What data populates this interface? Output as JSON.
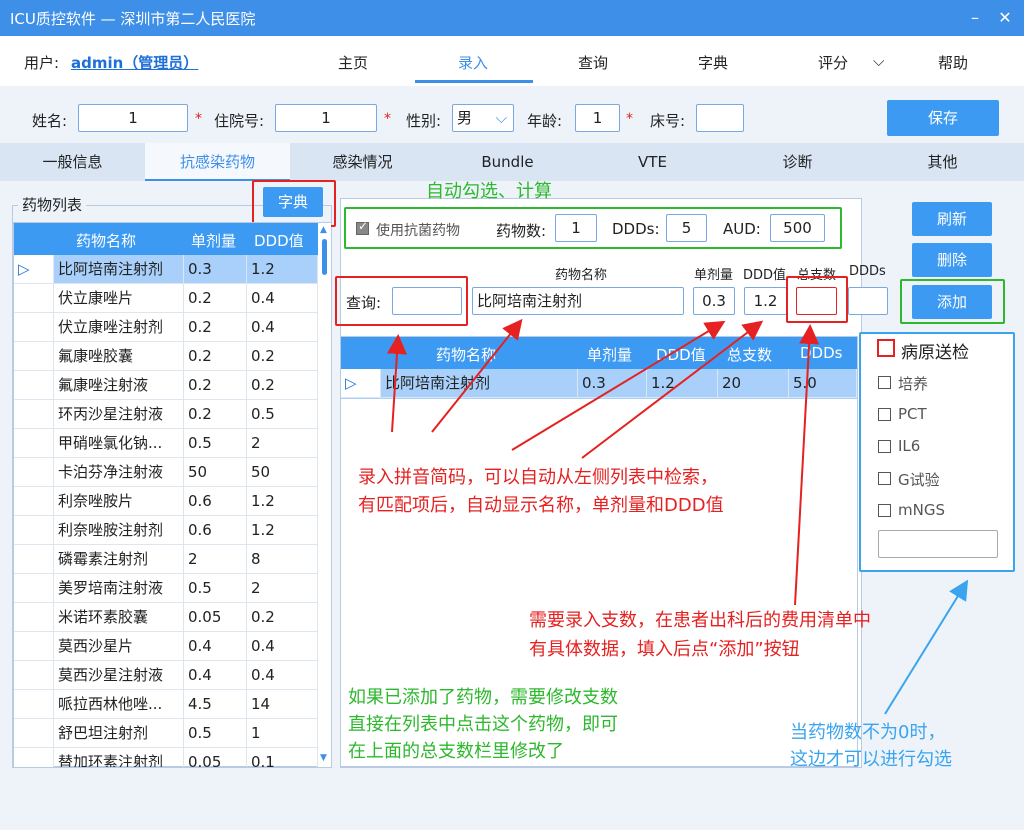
{
  "window": {
    "title": "ICU质控软件 — 深圳市第二人民医院",
    "minimize_icon": "minimize-icon",
    "close_icon": "close-icon"
  },
  "menu": {
    "user_label": "用户:",
    "user_name": "admin（管理员）",
    "items": [
      "主页",
      "录入",
      "查询",
      "字典",
      "评分",
      "帮助"
    ],
    "active": "录入"
  },
  "patient": {
    "name_label": "姓名:",
    "name_value": "1",
    "admission_label": "住院号:",
    "admission_value": "1",
    "gender_label": "性别:",
    "gender_value": "男",
    "age_label": "年龄:",
    "age_value": "1",
    "bed_label": "床号:",
    "bed_value": "",
    "save_label": "保存"
  },
  "tabs": [
    "一般信息",
    "抗感染药物",
    "感染情况",
    "Bundle",
    "VTE",
    "诊断",
    "其他"
  ],
  "drug_list": {
    "group_label": "药物列表",
    "dict_button": "字典",
    "columns": [
      "药物名称",
      "单剂量",
      "DDD值"
    ],
    "rows": [
      [
        "比阿培南注射剂",
        "0.3",
        "1.2"
      ],
      [
        "伏立康唑片",
        "0.2",
        "0.4"
      ],
      [
        "伏立康唑注射剂",
        "0.2",
        "0.4"
      ],
      [
        "氟康唑胶囊",
        "0.2",
        "0.2"
      ],
      [
        "氟康唑注射液",
        "0.2",
        "0.2"
      ],
      [
        "环丙沙星注射液",
        "0.2",
        "0.5"
      ],
      [
        "甲硝唑氯化钠...",
        "0.5",
        "2"
      ],
      [
        "卡泊芬净注射液",
        "50",
        "50"
      ],
      [
        "利奈唑胺片",
        "0.6",
        "1.2"
      ],
      [
        "利奈唑胺注射剂",
        "0.6",
        "1.2"
      ],
      [
        "磷霉素注射剂",
        "2",
        "8"
      ],
      [
        "美罗培南注射液",
        "0.5",
        "2"
      ],
      [
        "米诺环素胶囊",
        "0.05",
        "0.2"
      ],
      [
        "莫西沙星片",
        "0.4",
        "0.4"
      ],
      [
        "莫西沙星注射液",
        "0.4",
        "0.4"
      ],
      [
        "哌拉西林他唑...",
        "4.5",
        "14"
      ],
      [
        "舒巴坦注射剂",
        "0.5",
        "1"
      ],
      [
        "替加环素注射剂",
        "0.05",
        "0.1"
      ]
    ]
  },
  "summary": {
    "use_antibiotics_label": "使用抗菌药物",
    "drug_count_label": "药物数:",
    "drug_count": "1",
    "ddds_label": "DDDs:",
    "ddds": "5",
    "aud_label": "AUD:",
    "aud": "500"
  },
  "entry": {
    "query_label": "查询:",
    "query_value": "",
    "name_header": "药物名称",
    "dose_header": "单剂量",
    "ddd_header": "DDD值",
    "total_header": "总支数",
    "ddds_header": "DDDs",
    "name_value": "比阿培南注射剂",
    "dose_value": "0.3",
    "ddd_value": "1.2",
    "total_value": "",
    "ddds_value": ""
  },
  "actions": {
    "refresh": "刷新",
    "delete": "删除",
    "add": "添加"
  },
  "added_grid": {
    "columns": [
      "药物名称",
      "单剂量",
      "DDD值",
      "总支数",
      "DDDs"
    ],
    "rows": [
      [
        "比阿培南注射剂",
        "0.3",
        "1.2",
        "20",
        "5.0"
      ]
    ]
  },
  "pathogen": {
    "title": "病原送检",
    "options": [
      "培养",
      "PCT",
      "IL6",
      "G试验",
      "mNGS"
    ],
    "other_value": ""
  },
  "annotations": {
    "auto_calc": "自动勾选、计算",
    "query_hint_1": "录入拼音简码，可以自动从左侧列表中检索，",
    "query_hint_2": "有匹配项后，自动显示名称，单剂量和DDD值",
    "total_hint_1": "需要录入支数，在患者出科后的费用清单中",
    "total_hint_2": "有具体数据，填入后点“添加”按钮",
    "edit_hint_1": "如果已添加了药物，需要修改支数",
    "edit_hint_2": "直接在列表中点击这个药物，即可",
    "edit_hint_3": "在上面的总支数栏里修改了",
    "pathogen_hint_1": "当药物数不为0时，",
    "pathogen_hint_2": "这边才可以进行勾选"
  },
  "colors": {
    "accent": "#3d8fe8",
    "annotation_red": "#e52121",
    "annotation_green": "#2db82d",
    "annotation_blue": "#3aa4ee"
  }
}
